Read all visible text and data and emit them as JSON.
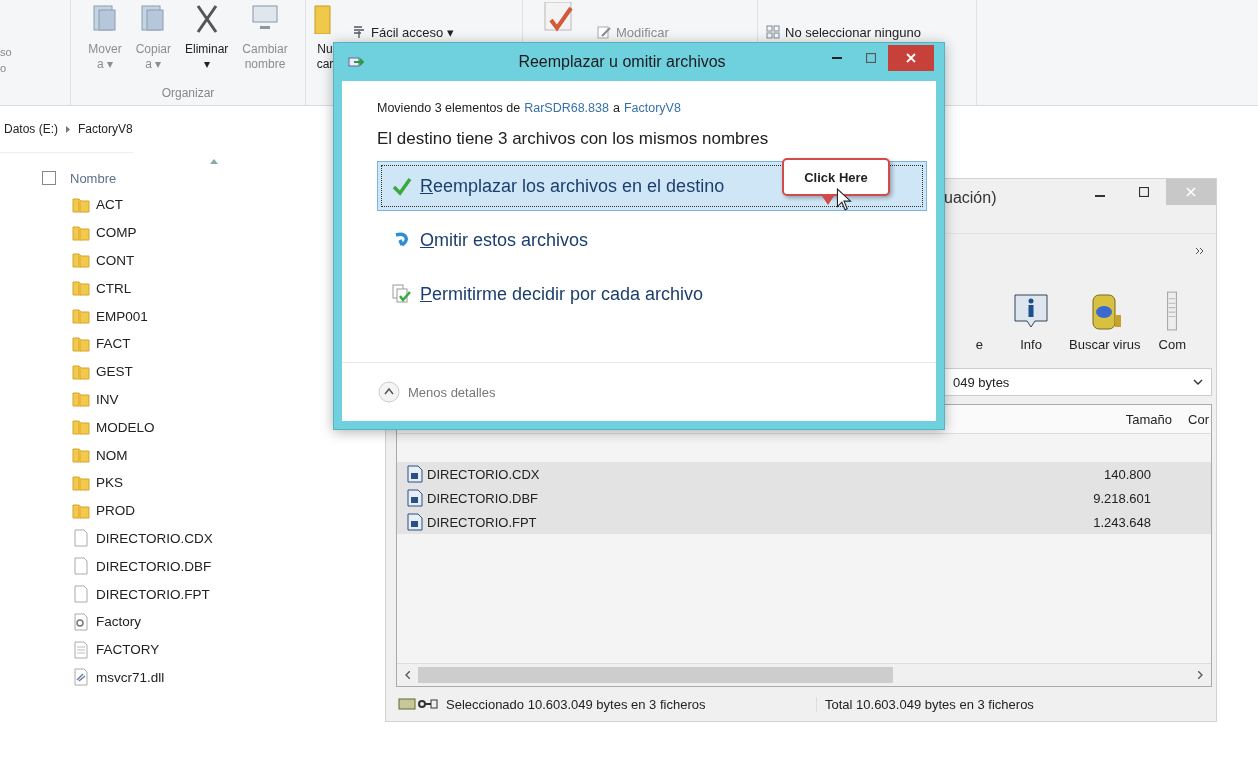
{
  "ribbon": {
    "fragments": [
      "so",
      "o"
    ],
    "large_buttons": [
      {
        "lines": [
          "Mover",
          "a ▾"
        ],
        "disabled": true
      },
      {
        "lines": [
          "Copiar",
          "a ▾"
        ],
        "disabled": true
      },
      {
        "lines": [
          "Eliminar",
          "▾"
        ],
        "disabled": false
      },
      {
        "lines": [
          "Cambiar",
          "nombre"
        ],
        "disabled": true
      }
    ],
    "group_label": "Organizar",
    "new_button": {
      "lines": [
        "Nu",
        "car"
      ],
      "disabled": false
    },
    "small_buttons": [
      {
        "label": "Fácil acceso ▾",
        "disabled": false
      },
      {
        "label": "Modificar",
        "disabled": true
      },
      {
        "label": "No seleccionar ninguno",
        "disabled": false
      }
    ]
  },
  "address": {
    "segments": [
      "Datos (E:)",
      "FactoryV8"
    ]
  },
  "file_list": {
    "header": "Nombre",
    "select_all_checked": false,
    "items": [
      {
        "name": "ACT",
        "kind": "folder"
      },
      {
        "name": "COMP",
        "kind": "folder"
      },
      {
        "name": "CONT",
        "kind": "folder"
      },
      {
        "name": "CTRL",
        "kind": "folder"
      },
      {
        "name": "EMP001",
        "kind": "folder"
      },
      {
        "name": "FACT",
        "kind": "folder"
      },
      {
        "name": "GEST",
        "kind": "folder"
      },
      {
        "name": "INV",
        "kind": "folder"
      },
      {
        "name": "MODELO",
        "kind": "folder"
      },
      {
        "name": "NOM",
        "kind": "folder"
      },
      {
        "name": "PKS",
        "kind": "folder"
      },
      {
        "name": "PROD",
        "kind": "folder"
      },
      {
        "name": "DIRECTORIO.CDX",
        "kind": "file"
      },
      {
        "name": "DIRECTORIO.DBF",
        "kind": "file"
      },
      {
        "name": "DIRECTORIO.FPT",
        "kind": "file"
      },
      {
        "name": "Factory",
        "kind": "config"
      },
      {
        "name": "FACTORY",
        "kind": "text"
      },
      {
        "name": "msvcr71.dll",
        "kind": "library"
      }
    ]
  },
  "archive_window": {
    "title": "uación)",
    "toolbar": [
      {
        "label": "e"
      },
      {
        "label": "Info"
      },
      {
        "label": "Buscar virus"
      },
      {
        "label": "Com"
      }
    ],
    "path": "049 bytes",
    "columns": [
      "Tamaño",
      "Cor"
    ],
    "rows": [
      {
        "name": "DIRECTORIO.CDX",
        "size": "140.800",
        "selected": true
      },
      {
        "name": "DIRECTORIO.DBF",
        "size": "9.218.601",
        "selected": true
      },
      {
        "name": "DIRECTORIO.FPT",
        "size": "1.243.648",
        "selected": true
      }
    ],
    "status": {
      "selected": "Seleccionado 10.603.049 bytes en 3 ficheros",
      "total": "Total 10.603.049 bytes en 3 ficheros"
    }
  },
  "dialog": {
    "title": "Reemplazar u omitir archivos",
    "subtitle": {
      "prefix": "Moviendo 3 elementos de",
      "source": "RarSDR68.838",
      "middle": "a",
      "destination": "FactoryV8"
    },
    "heading": "El destino tiene 3 archivos con los mismos nombres",
    "options": [
      {
        "label": "Reemplazar los archivos en el destino",
        "selected": true
      },
      {
        "label": "Omitir estos archivos",
        "selected": false
      },
      {
        "label": "Permitirme decidir por cada archivo",
        "selected": false
      }
    ],
    "details_toggle": "Menos detalles"
  },
  "callout": {
    "text": "Click Here"
  }
}
